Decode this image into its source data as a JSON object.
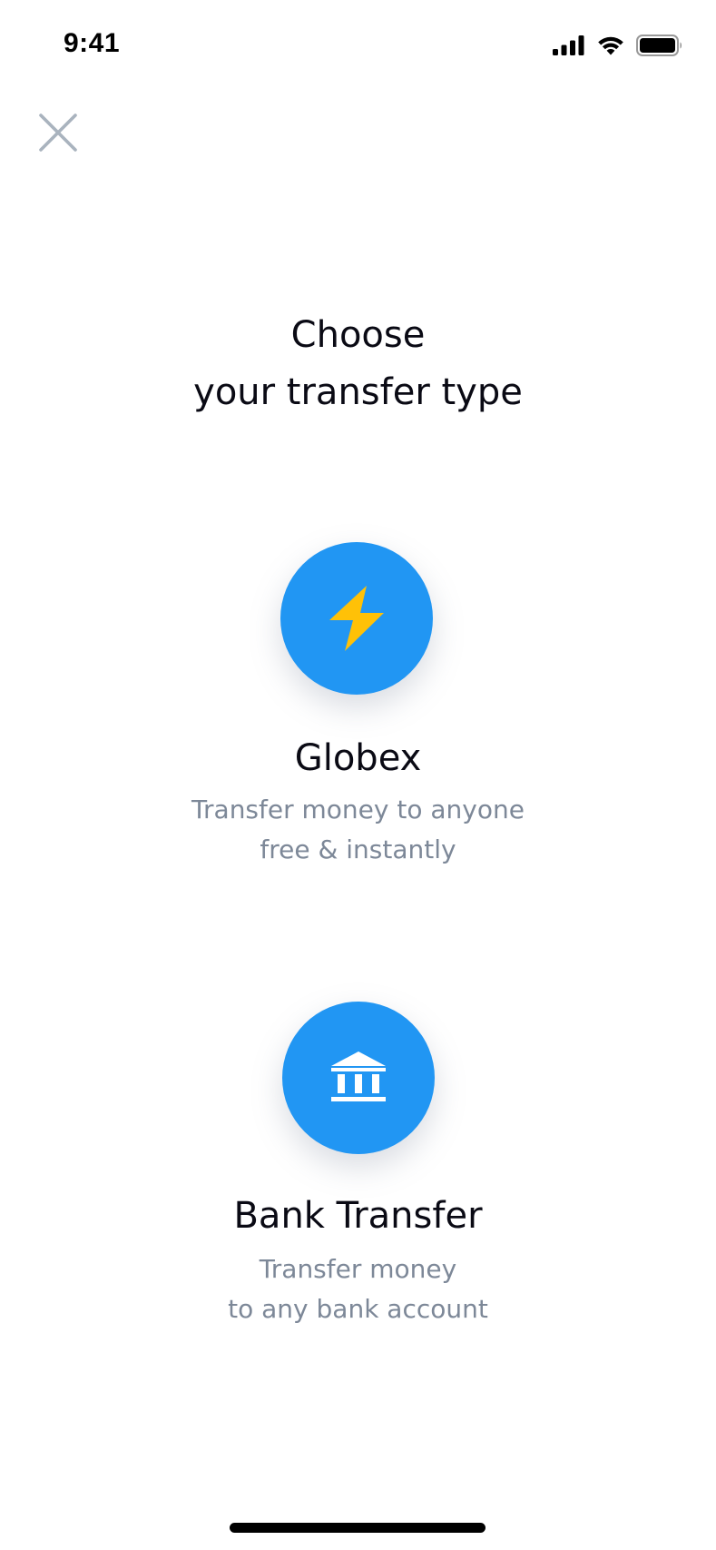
{
  "status_bar": {
    "time": "9:41",
    "icons": [
      "signal-icon",
      "wifi-icon",
      "battery-icon"
    ]
  },
  "close_button": {
    "icon": "close-icon",
    "color": "#a9b3be"
  },
  "header": {
    "title_line1": "Choose",
    "title_line2": "your transfer type"
  },
  "options": [
    {
      "title": "Globex",
      "description_line1": "Transfer money to anyone",
      "description_line2": "free & instantly",
      "icon": "lightning-bolt-icon",
      "icon_color": "#ffc107"
    },
    {
      "title": "Bank Transfer",
      "description_line1": "Transfer money",
      "description_line2": "to any bank account",
      "icon": "bank-icon",
      "icon_color": "#ffffff"
    }
  ],
  "colors": {
    "accent": "#2196f3",
    "text_primary": "#0a0a14",
    "text_secondary": "#7d8898",
    "background": "#ffffff"
  }
}
